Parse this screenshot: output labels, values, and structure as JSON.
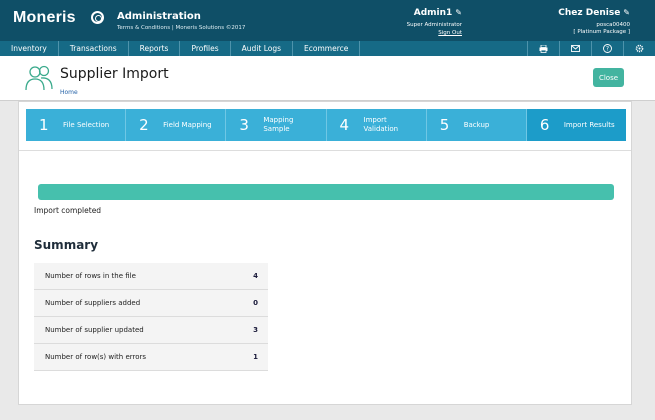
{
  "header": {
    "brand": "Moneris",
    "title": "Administration",
    "subtitle": "Terms & Conditions | Moneris Solutions ©2017",
    "user_name": "Admin1",
    "user_role": "Super Administrator",
    "sign_out": "Sign Out",
    "merchant_name": "Chez Denise",
    "merchant_id": "posca00400",
    "merchant_package": "[ Platinum Package ]"
  },
  "nav": {
    "items": [
      "Inventory",
      "Transactions",
      "Reports",
      "Profiles",
      "Audit Logs",
      "Ecommerce"
    ],
    "icons": [
      "printer-icon",
      "mail-icon",
      "help-icon",
      "settings-icon"
    ]
  },
  "page": {
    "title": "Supplier Import",
    "breadcrumb": "Home",
    "close_label": "Close"
  },
  "steps": [
    {
      "num": "1",
      "label": "File Selection"
    },
    {
      "num": "2",
      "label": "Field Mapping"
    },
    {
      "num": "3",
      "label": "Mapping Sample"
    },
    {
      "num": "4",
      "label": "Import Validation"
    },
    {
      "num": "5",
      "label": "Backup"
    },
    {
      "num": "6",
      "label": "Import Results"
    }
  ],
  "progress": {
    "percent": 100,
    "status": "Import completed"
  },
  "summary": {
    "title": "Summary",
    "rows": [
      {
        "label": "Number of rows in the file",
        "value": "4"
      },
      {
        "label": "Number of suppliers added",
        "value": "0"
      },
      {
        "label": "Number of supplier updated",
        "value": "3"
      },
      {
        "label": "Number of row(s) with errors",
        "value": "1"
      }
    ]
  },
  "colors": {
    "header": "#0f4f67",
    "nav": "#166a86",
    "step": "#3ab0d8",
    "accent": "#43b4a0"
  }
}
